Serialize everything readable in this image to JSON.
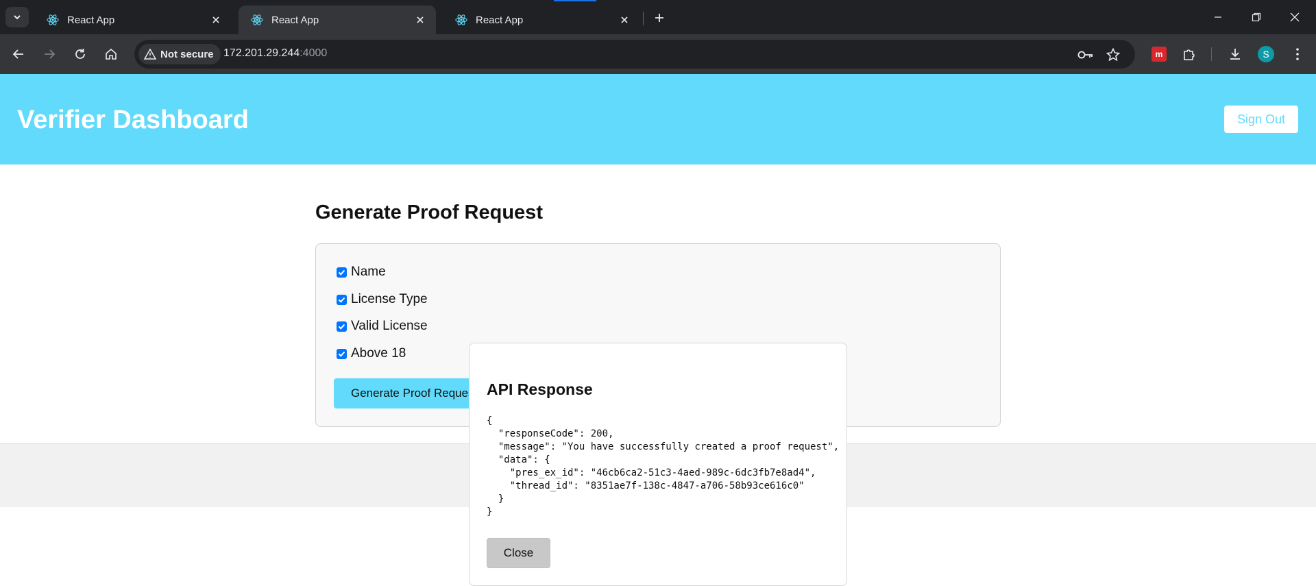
{
  "browser": {
    "tabs": [
      {
        "title": "React App",
        "icon": "react-icon",
        "active": false
      },
      {
        "title": "React App",
        "icon": "react-icon",
        "active": true
      },
      {
        "title": "React App",
        "icon": "react-icon",
        "active": false
      }
    ],
    "security_label": "Not secure",
    "url_host": "172.201.29.244",
    "url_port": ":4000",
    "profile_initial": "S"
  },
  "header": {
    "title": "Verifier Dashboard",
    "sign_out_label": "Sign Out"
  },
  "form": {
    "title": "Generate Proof Request",
    "options": [
      {
        "label": "Name",
        "checked": true
      },
      {
        "label": "License Type",
        "checked": true
      },
      {
        "label": "Valid License",
        "checked": true
      },
      {
        "label": "Above 18",
        "checked": true
      }
    ],
    "submit_label": "Generate Proof Request"
  },
  "modal": {
    "title": "API Response",
    "json_text": "{\n  \"responseCode\": 200,\n  \"message\": \"You have successfully created a proof request\",\n  \"data\": {\n    \"pres_ex_id\": \"46cb6ca2-51c3-4aed-989c-6dc3fb7e8ad4\",\n    \"thread_id\": \"8351ae7f-138c-4847-a706-58b93ce616c0\"\n  }\n}",
    "close_label": "Close"
  },
  "colors": {
    "accent": "#61dafb",
    "checkbox": "#0075ff",
    "chrome_dark": "#202124",
    "chrome_mid": "#35363a"
  }
}
